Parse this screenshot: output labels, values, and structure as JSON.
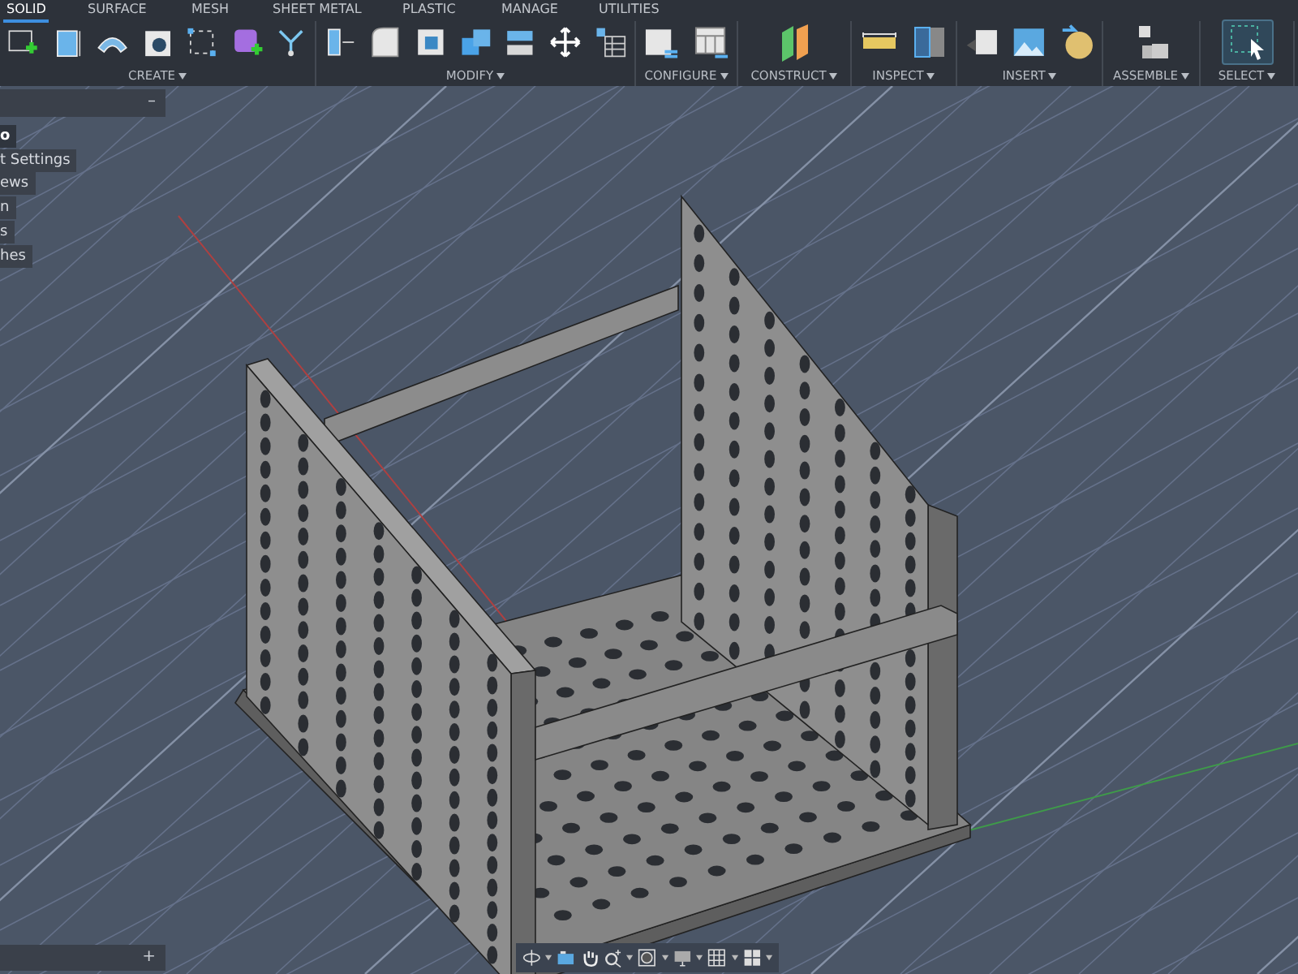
{
  "tabs": [
    {
      "label": "SOLID",
      "selected": true
    },
    {
      "label": "SURFACE",
      "selected": false
    },
    {
      "label": "MESH",
      "selected": false
    },
    {
      "label": "SHEET METAL",
      "selected": false
    },
    {
      "label": "PLASTIC",
      "selected": false
    },
    {
      "label": "MANAGE",
      "selected": false
    },
    {
      "label": "UTILITIES",
      "selected": false
    }
  ],
  "tool_groups": [
    {
      "label": "CREATE"
    },
    {
      "label": "MODIFY"
    },
    {
      "label": "CONFIGURE"
    },
    {
      "label": "CONSTRUCT"
    },
    {
      "label": "INSPECT"
    },
    {
      "label": "INSERT"
    },
    {
      "label": "ASSEMBLE"
    },
    {
      "label": "SELECT",
      "selected": true
    }
  ],
  "browser": {
    "collapse": "–",
    "items": [
      {
        "label": "o",
        "selected": true
      },
      {
        "label": "t Settings",
        "selected": false
      },
      {
        "label": "ews",
        "selected": false
      },
      {
        "label": "n",
        "selected": false
      },
      {
        "label": "s",
        "selected": false
      },
      {
        "label": "hes",
        "selected": false
      }
    ]
  },
  "comments_panel": {
    "expand": "+"
  }
}
